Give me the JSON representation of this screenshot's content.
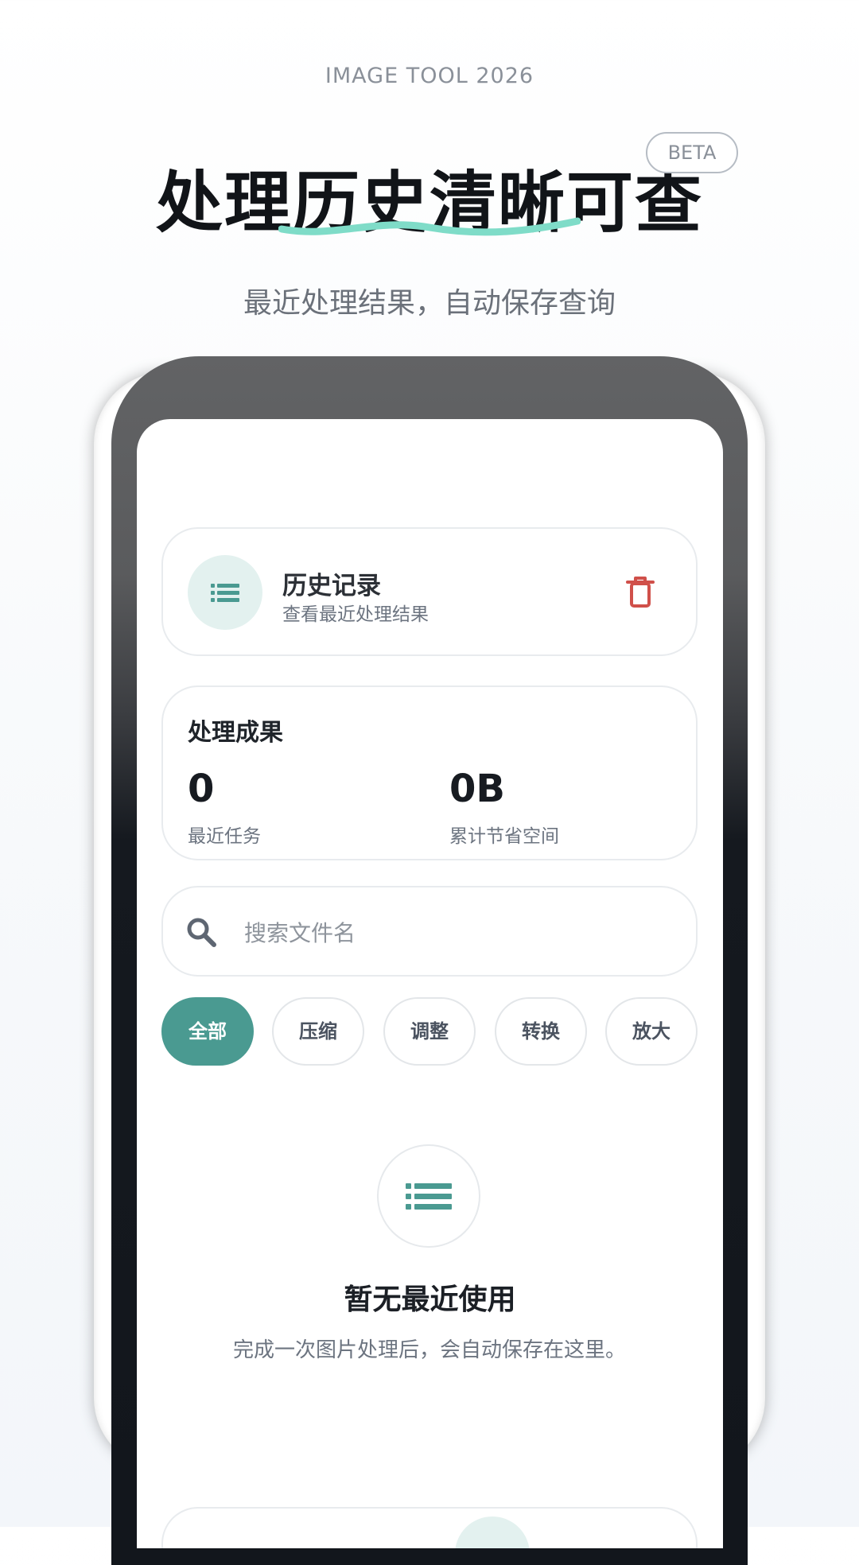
{
  "header": {
    "brand": "IMAGE TOOL 2026",
    "headline_pre": "处理",
    "headline_highlight": "历史清晰",
    "headline_post": "可查",
    "badge": "BETA",
    "tagline": "最近处理结果，自动保存查询"
  },
  "history_card": {
    "title": "历史记录",
    "subtitle": "查看最近处理结果",
    "icon": "list-icon",
    "action_icon": "trash-icon"
  },
  "results": {
    "title": "处理成果",
    "stats": [
      {
        "value": "0",
        "label": "最近任务"
      },
      {
        "value": "0B",
        "label": "累计节省空间"
      }
    ]
  },
  "search": {
    "placeholder": "搜索文件名",
    "value": "",
    "icon": "search-icon"
  },
  "filters": [
    {
      "label": "全部",
      "active": true
    },
    {
      "label": "压缩",
      "active": false
    },
    {
      "label": "调整",
      "active": false
    },
    {
      "label": "转换",
      "active": false
    },
    {
      "label": "放大",
      "active": false
    }
  ],
  "empty_state": {
    "icon": "list-icon",
    "title": "暂无最近使用",
    "description": "完成一次图片处理后，会自动保存在这里。"
  },
  "colors": {
    "accent": "#4a9a91",
    "accent_light": "#e3f1ef",
    "danger": "#d0504a",
    "swoosh": "#7fdcc8"
  }
}
